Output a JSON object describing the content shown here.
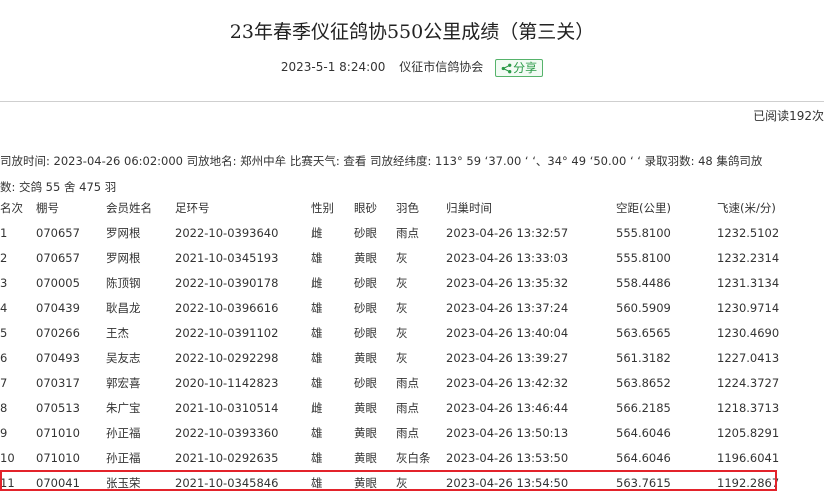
{
  "header": {
    "title": "23年春季仪征鸽协550公里成绩（第三关）",
    "datetime": "2023-5-1  8:24:00",
    "org": "仪征市信鸽协会",
    "share_label": "分享"
  },
  "read_count": "已阅读192次",
  "race_info": {
    "line1": "司放时间: 2023-04-26 06:02:000 司放地名: 郑州中牟 比赛天气: 查看 司放经纬度: 113° 59 ‘37.00 ‘ ‘、34° 49 ‘50.00 ‘ ‘ 录取羽数: 48 集鸽司放",
    "line2": "数: 交鸽 55 舍 475 羽"
  },
  "table": {
    "columns": [
      "名次",
      "棚号",
      "会员姓名",
      "足环号",
      "性别",
      "眼砂",
      "羽色",
      "归巢时间",
      "空距(公里)",
      "飞速(米/分)"
    ],
    "rows": [
      [
        "1",
        "070657",
        "罗网根",
        "2022-10-0393640",
        "雌",
        "砂眼",
        "雨点",
        "2023-04-26 13:32:57",
        "555.8100",
        "1232.5102"
      ],
      [
        "2",
        "070657",
        "罗网根",
        "2021-10-0345193",
        "雄",
        "黄眼",
        "灰",
        "2023-04-26 13:33:03",
        "555.8100",
        "1232.2314"
      ],
      [
        "3",
        "070005",
        "陈顶钢",
        "2022-10-0390178",
        "雌",
        "砂眼",
        "灰",
        "2023-04-26 13:35:32",
        "558.4486",
        "1231.3134"
      ],
      [
        "4",
        "070439",
        "耿昌龙",
        "2022-10-0396616",
        "雄",
        "砂眼",
        "灰",
        "2023-04-26 13:37:24",
        "560.5909",
        "1230.9714"
      ],
      [
        "5",
        "070266",
        "王杰",
        "2022-10-0391102",
        "雄",
        "砂眼",
        "灰",
        "2023-04-26 13:40:04",
        "563.6565",
        "1230.4690"
      ],
      [
        "6",
        "070493",
        "吴友志",
        "2022-10-0292298",
        "雄",
        "黄眼",
        "灰",
        "2023-04-26 13:39:27",
        "561.3182",
        "1227.0413"
      ],
      [
        "7",
        "070317",
        "郭宏喜",
        "2020-10-1142823",
        "雄",
        "砂眼",
        "雨点",
        "2023-04-26 13:42:32",
        "563.8652",
        "1224.3727"
      ],
      [
        "8",
        "070513",
        "朱广宝",
        "2021-10-0310514",
        "雌",
        "黄眼",
        "雨点",
        "2023-04-26 13:46:44",
        "566.2185",
        "1218.3713"
      ],
      [
        "9",
        "071010",
        "孙正福",
        "2022-10-0393360",
        "雄",
        "黄眼",
        "雨点",
        "2023-04-26 13:50:13",
        "564.6046",
        "1205.8291"
      ],
      [
        "10",
        "071010",
        "孙正福",
        "2021-10-0292635",
        "雄",
        "黄眼",
        "灰白条",
        "2023-04-26 13:53:50",
        "564.6046",
        "1196.6041"
      ],
      [
        "11",
        "070041",
        "张玉荣",
        "2021-10-0345846",
        "雄",
        "黄眼",
        "灰",
        "2023-04-26 13:54:50",
        "563.7615",
        "1192.2867"
      ]
    ]
  },
  "colors": {
    "highlight_border": "#e3232b",
    "share_green": "#2a9a47"
  }
}
